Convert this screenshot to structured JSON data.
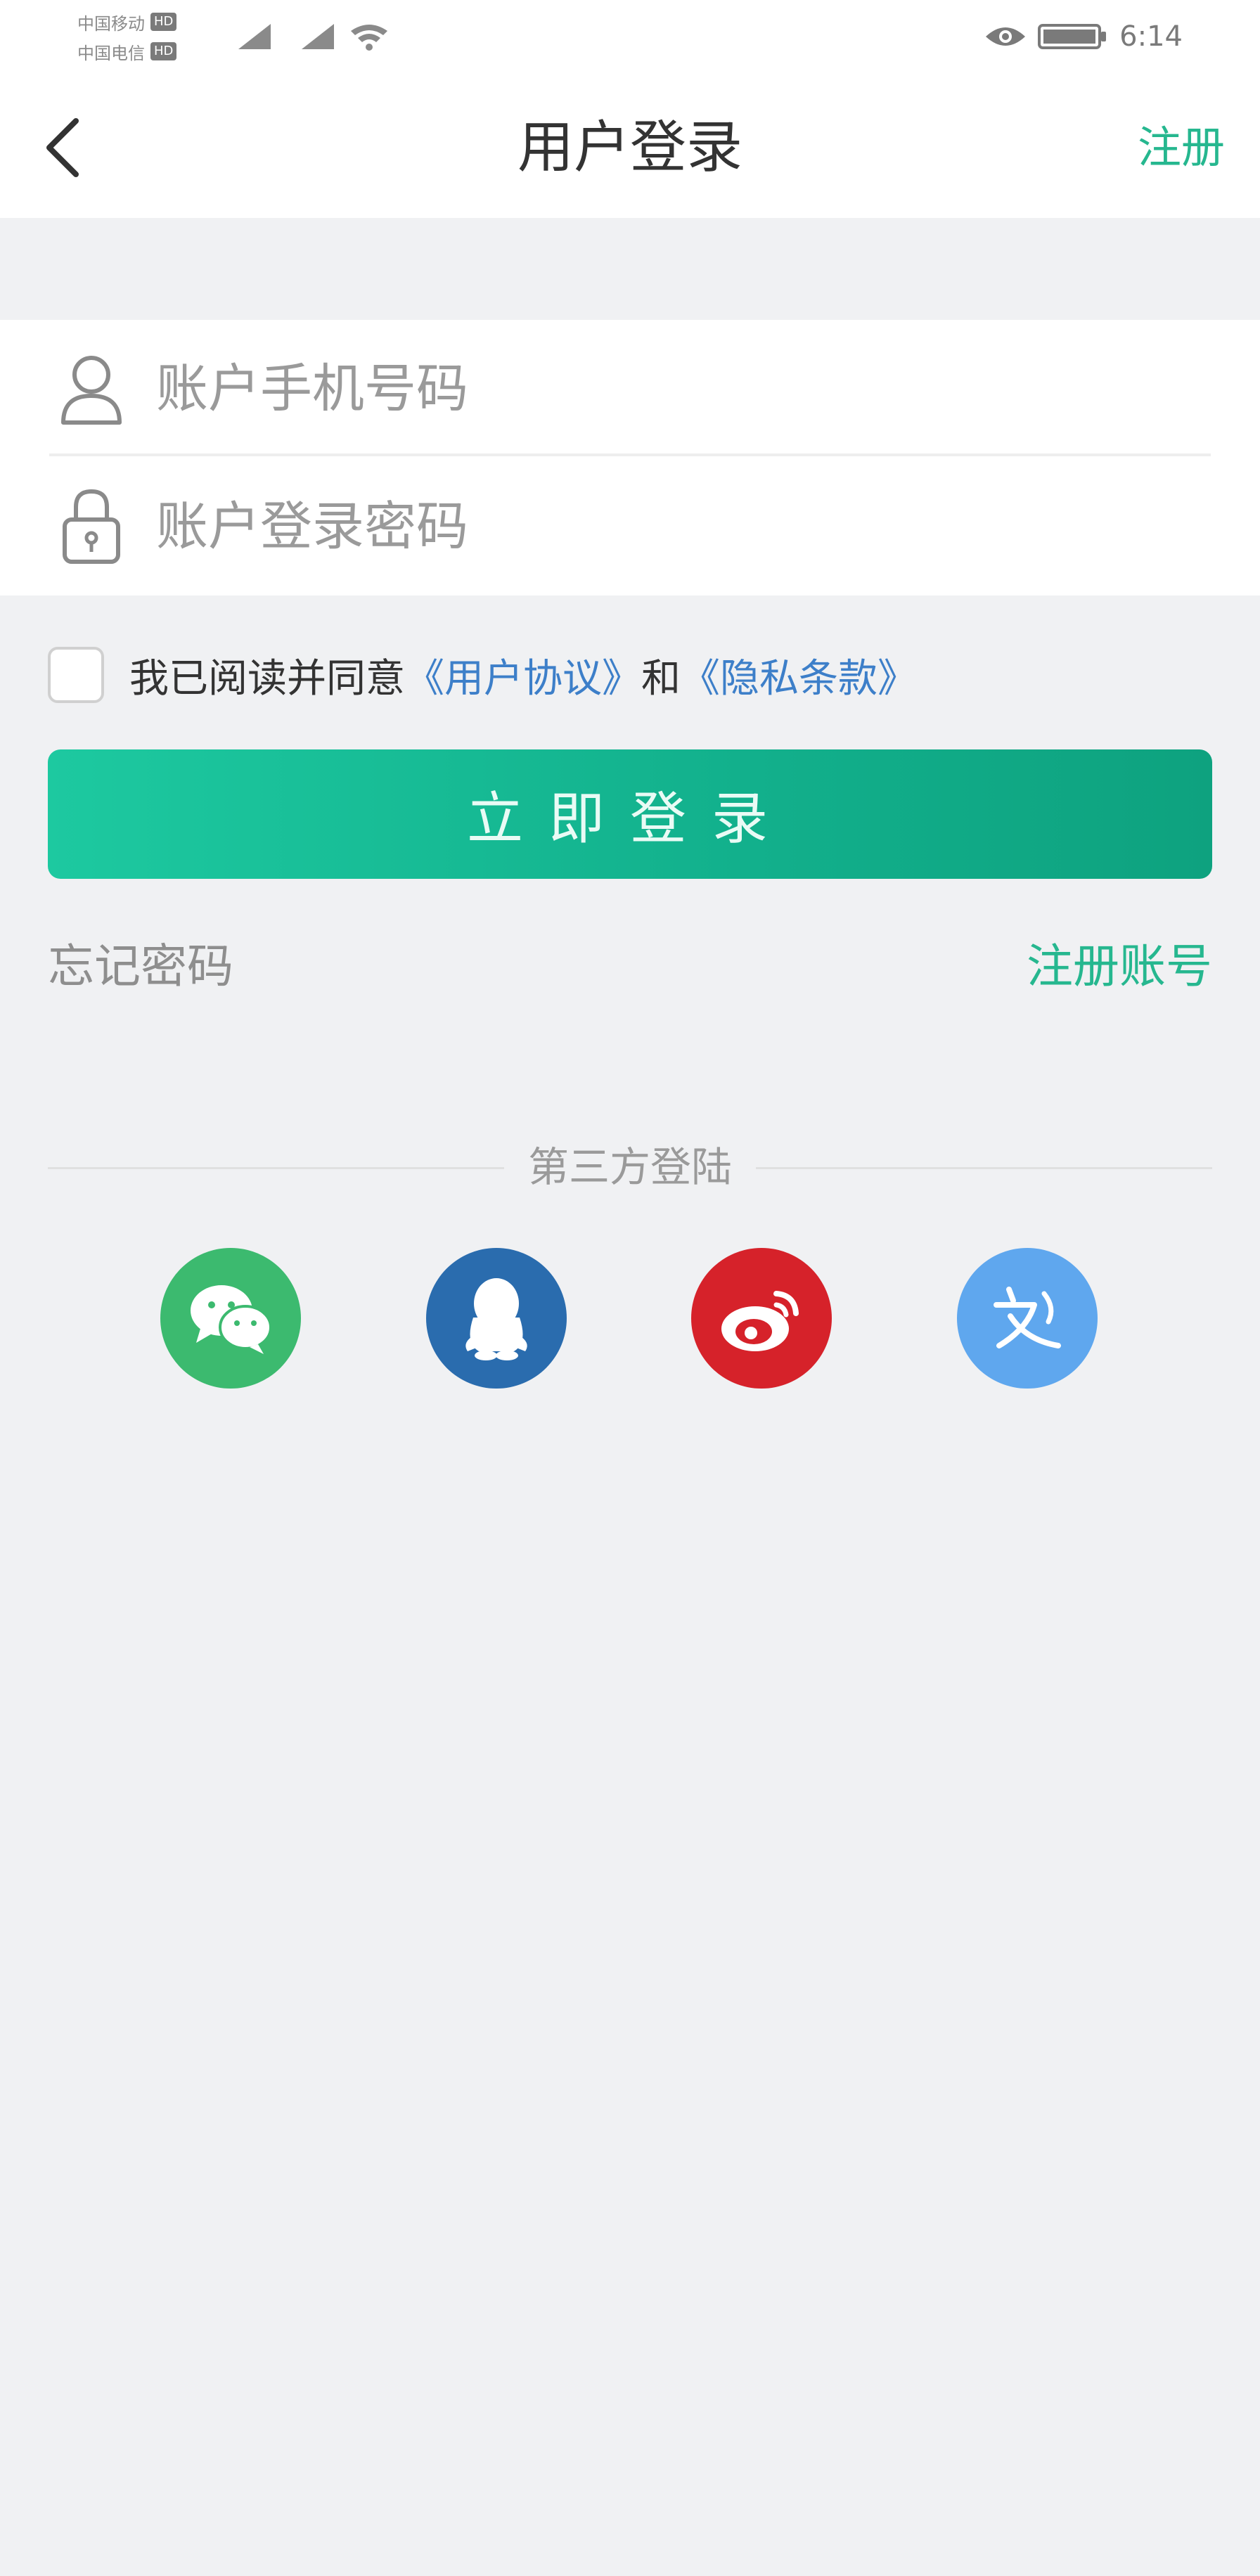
{
  "status_bar": {
    "carrier_1": "中国移动",
    "carrier_2": "中国电信",
    "hd_badge": "HD",
    "time": "6:14"
  },
  "nav": {
    "title": "用户登录",
    "register_label": "注册"
  },
  "form": {
    "phone_placeholder": "账户手机号码",
    "password_placeholder": "账户登录密码"
  },
  "agreement": {
    "prefix": "我已阅读并同意",
    "user_agreement": "《用户协议》",
    "conjunction": "和",
    "privacy_policy": "《隐私条款》"
  },
  "login_button_label": "立即登录",
  "links": {
    "forgot_password": "忘记密码",
    "register_account": "注册账号"
  },
  "third_party": {
    "label": "第三方登陆",
    "providers": [
      "wechat-icon",
      "qq-icon",
      "weibo-icon",
      "other-login-icon"
    ]
  },
  "colors": {
    "accent": "#26b78f",
    "link": "#3d7fc9",
    "wechat": "#3cba6f",
    "qq": "#2a6cae",
    "weibo": "#d6222a",
    "other": "#5fa7ee"
  }
}
